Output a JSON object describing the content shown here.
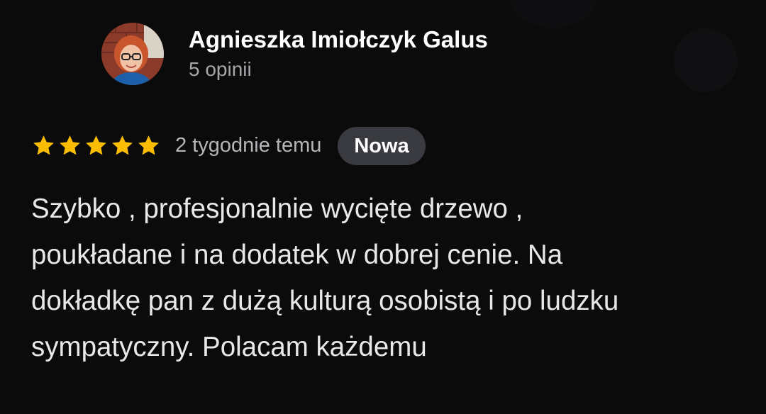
{
  "review": {
    "author": {
      "name": "Agnieszka Imiołczyk Galus",
      "review_count": "5 opinii",
      "avatar": "profile-photo"
    },
    "rating": 5,
    "rating_max": 5,
    "time_ago": "2 tygodnie temu",
    "badge": "Nowa",
    "text_lines": [
      "Szybko , profesjonalnie wycięte drzewo ,",
      "poukładane i na dodatek w dobrej cenie. Na",
      "dokładkę pan z dużą kulturą osobistą i po ludzku",
      "sympatyczny. Polacam każdemu"
    ]
  },
  "colors": {
    "background": "#0b0b0c",
    "star": "#fbbc04",
    "badge_bg": "#3a3b40",
    "primary_text": "#ffffff",
    "secondary_text": "#a7a7ab"
  }
}
